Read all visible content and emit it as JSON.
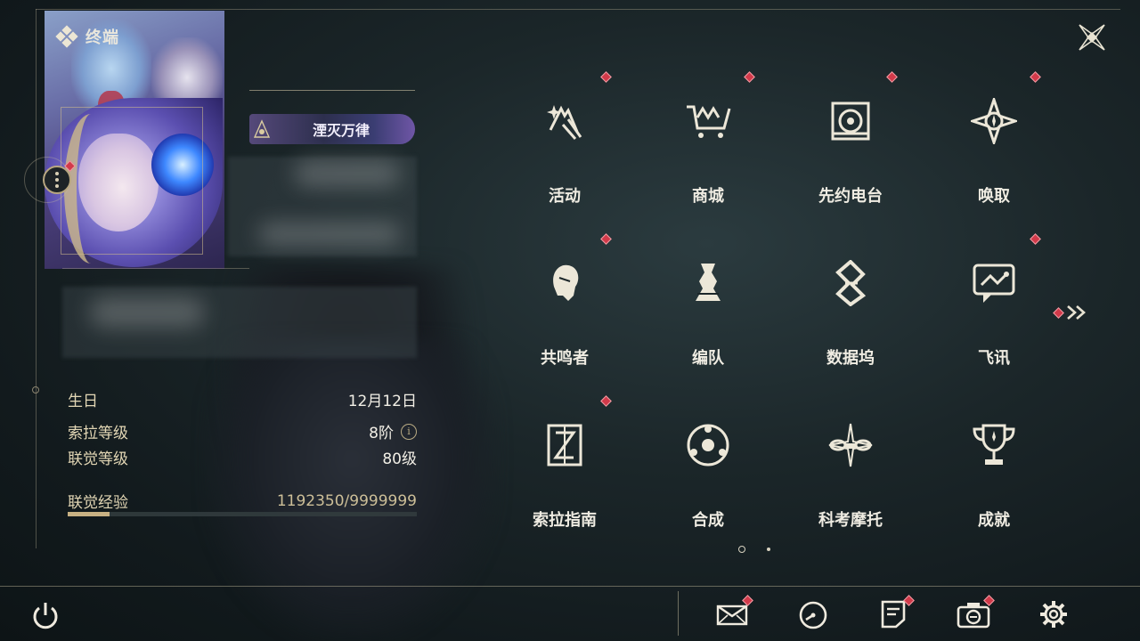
{
  "header": {
    "title": "终端"
  },
  "profile": {
    "title_badge": "湮灭万律"
  },
  "stats": {
    "birthday_label": "生日",
    "birthday_value": "12月12日",
    "sora_level_label": "索拉等级",
    "sora_level_value": "8阶",
    "union_level_label": "联觉等级",
    "union_level_value": "80级",
    "union_exp_label": "联觉经验",
    "union_exp_value": "1192350/9999999",
    "union_exp_fraction": 0.1192
  },
  "menu": {
    "items": [
      {
        "label": "活动",
        "icon": "events-icon",
        "badge": true
      },
      {
        "label": "商城",
        "icon": "shop-cart-icon",
        "badge": true
      },
      {
        "label": "先约电台",
        "icon": "radio-icon",
        "badge": true
      },
      {
        "label": "唤取",
        "icon": "convene-icon",
        "badge": true
      },
      {
        "label": "共鸣者",
        "icon": "resonator-icon",
        "badge": true
      },
      {
        "label": "编队",
        "icon": "team-chess-icon",
        "badge": false
      },
      {
        "label": "数据坞",
        "icon": "data-bank-icon",
        "badge": false
      },
      {
        "label": "飞讯",
        "icon": "message-icon",
        "badge": true
      },
      {
        "label": "索拉指南",
        "icon": "guidebook-icon",
        "badge": true
      },
      {
        "label": "合成",
        "icon": "synthesis-icon",
        "badge": false
      },
      {
        "label": "科考摩托",
        "icon": "motorcycle-icon",
        "badge": false
      },
      {
        "label": "成就",
        "icon": "trophy-icon",
        "badge": false
      }
    ]
  },
  "pagination": {
    "current": 1,
    "total": 2
  },
  "bottom_bar": {
    "buttons": [
      "mail-icon",
      "clock-icon",
      "notice-icon",
      "camera-icon",
      "settings-gear-icon"
    ]
  },
  "colors": {
    "accent_gold": "#c8b183",
    "badge_red": "#d23a4a",
    "background": "#1b2629"
  }
}
